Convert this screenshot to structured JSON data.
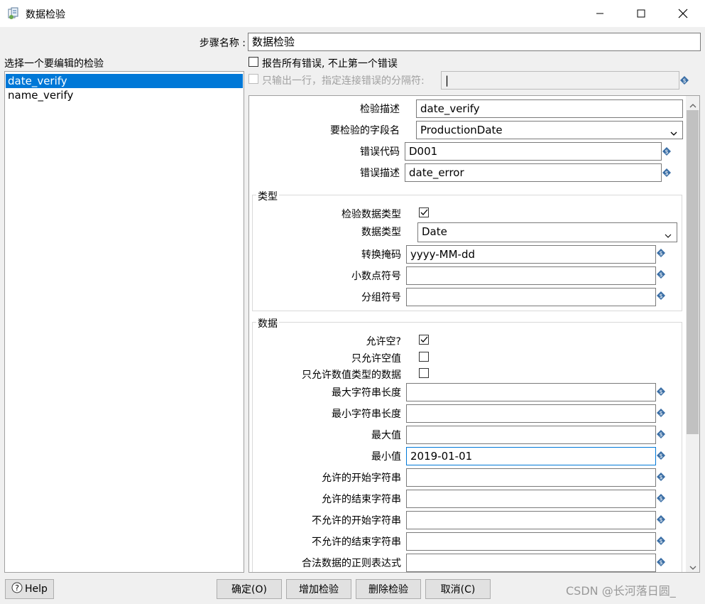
{
  "window": {
    "title": "数据检验"
  },
  "step_name": {
    "label": "步骤名称 :",
    "value": "数据检验"
  },
  "list": {
    "header": "选择一个要编辑的检验",
    "items": [
      "date_verify",
      "name_verify"
    ],
    "selected": "date_verify"
  },
  "options": {
    "report_all": "报告所有错误, 不止第一个错误",
    "single_row": "只输出一行，指定连接错误的分隔符:",
    "separator_value": "|"
  },
  "details": {
    "description": {
      "label": "检验描述",
      "value": "date_verify"
    },
    "field_name": {
      "label": "要检验的字段名",
      "value": "ProductionDate"
    },
    "error_code": {
      "label": "错误代码",
      "value": "D001"
    },
    "error_desc": {
      "label": "错误描述",
      "value": "date_error"
    }
  },
  "type_group": {
    "title": "类型",
    "check_type": {
      "label": "检验数据类型",
      "checked": true
    },
    "data_type": {
      "label": "数据类型",
      "value": "Date"
    },
    "mask": {
      "label": "转换掩码",
      "value": "yyyy-MM-dd"
    },
    "decimal": {
      "label": "小数点符号",
      "value": ""
    },
    "grouping": {
      "label": "分组符号",
      "value": ""
    }
  },
  "data_group": {
    "title": "数据",
    "allow_null": {
      "label": "允许空?",
      "checked": true
    },
    "only_null": {
      "label": "只允许空值",
      "checked": false
    },
    "only_numeric": {
      "label": "只允许数值类型的数据",
      "checked": false
    },
    "max_length": {
      "label": "最大字符串长度",
      "value": ""
    },
    "min_length": {
      "label": "最小字符串长度",
      "value": ""
    },
    "max_value": {
      "label": "最大值",
      "value": ""
    },
    "min_value": {
      "label": "最小值",
      "value": "2019-01-01"
    },
    "start_string": {
      "label": "允许的开始字符串",
      "value": ""
    },
    "end_string": {
      "label": "允许的结束字符串",
      "value": ""
    },
    "not_start_string": {
      "label": "不允许的开始字符串",
      "value": ""
    },
    "not_end_string": {
      "label": "不允许的结束字符串",
      "value": ""
    },
    "regex_allowed": {
      "label": "合法数据的正则表达式",
      "value": ""
    }
  },
  "buttons": {
    "help": "Help",
    "ok": "确定(O)",
    "add": "增加检验",
    "delete": "删除检验",
    "cancel": "取消(C)"
  },
  "watermark": "CSDN @长河落日圆_",
  "colors": {
    "selection": "#0078d7",
    "variable_icon": "#3a6ea5"
  }
}
